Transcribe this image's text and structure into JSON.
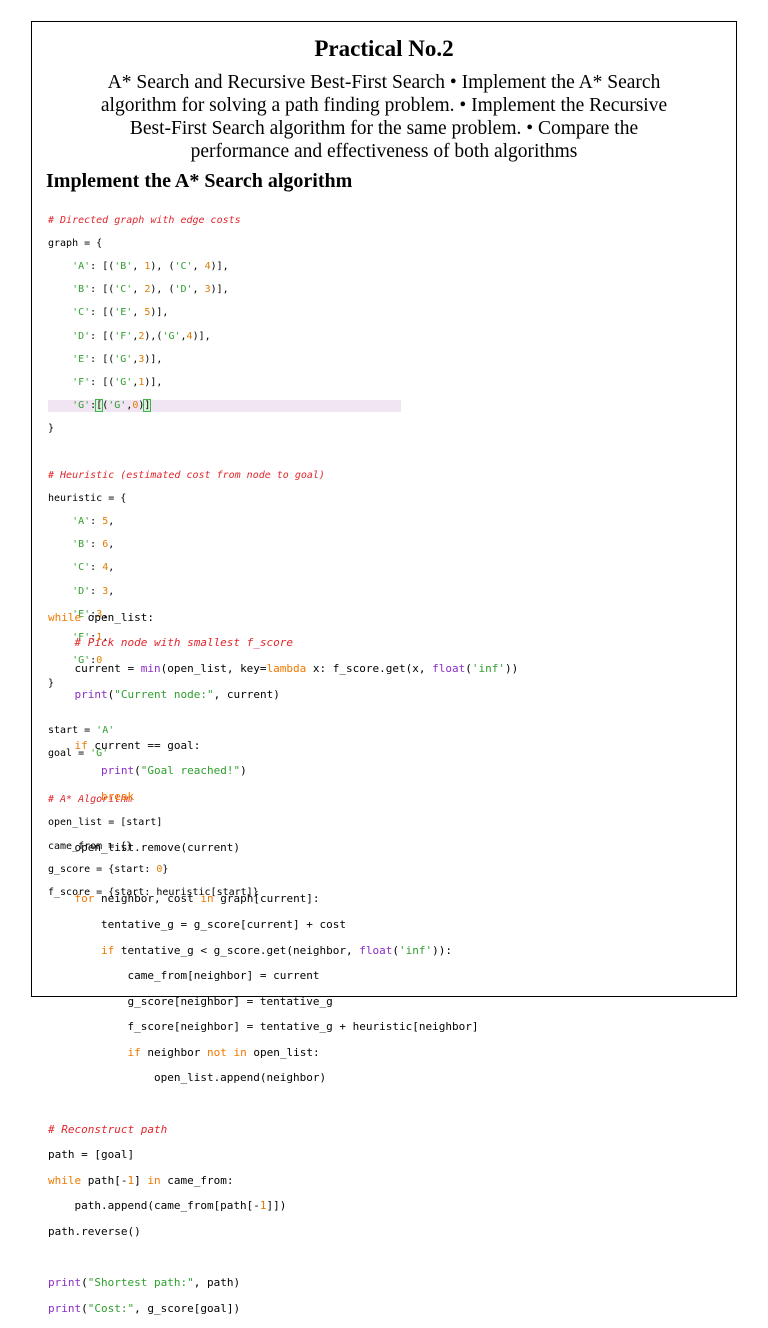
{
  "title": "Practical No.2",
  "description_lines": [
    "A* Search and Recursive Best-First Search • Implement the A* Search",
    "algorithm for solving a path finding problem. • Implement the Recursive",
    "Best-First Search algorithm for the same problem. • Compare the",
    "performance and effectiveness of both algorithms"
  ],
  "section_heading": "Implement the A* Search algorithm",
  "code_block_1": {
    "c1": "# Directed graph with edge costs",
    "l2": "graph = {",
    "l3a": "    ",
    "l3b": "'A'",
    "l3c": ": [(",
    "l3d": "'B'",
    "l3e": ", ",
    "l3f": "1",
    "l3g": "), (",
    "l3h": "'C'",
    "l3i": ", ",
    "l3j": "4",
    "l3k": ")],",
    "l4a": "    ",
    "l4b": "'B'",
    "l4c": ": [(",
    "l4d": "'C'",
    "l4e": ", ",
    "l4f": "2",
    "l4g": "), (",
    "l4h": "'D'",
    "l4i": ", ",
    "l4j": "3",
    "l4k": ")],",
    "l5a": "    ",
    "l5b": "'C'",
    "l5c": ": [(",
    "l5d": "'E'",
    "l5e": ", ",
    "l5f": "5",
    "l5g": ")],",
    "l6a": "    ",
    "l6b": "'D'",
    "l6c": ": [(",
    "l6d": "'F'",
    "l6e": ",",
    "l6f": "2",
    "l6g": "),(",
    "l6h": "'G'",
    "l6i": ",",
    "l6j": "4",
    "l6k": ")],",
    "l7a": "    ",
    "l7b": "'E'",
    "l7c": ": [(",
    "l7d": "'G'",
    "l7e": ",",
    "l7f": "3",
    "l7g": ")],",
    "l8a": "    ",
    "l8b": "'F'",
    "l8c": ": [(",
    "l8d": "'G'",
    "l8e": ",",
    "l8f": "1",
    "l8g": ")],",
    "l9a": "    ",
    "l9b": "'G'",
    "l9c": ":",
    "l9d": "[",
    "l9e": "(",
    "l9f": "'G'",
    "l9g": ",",
    "l9h": "0",
    "l9i": ")",
    "l9j": "]",
    "l10": "}",
    "c2": "# Heuristic (estimated cost from node to goal)",
    "h1": "heuristic = {",
    "h2a": "    ",
    "h2b": "'A'",
    "h2c": ": ",
    "h2d": "5",
    "h2e": ",",
    "h3a": "    ",
    "h3b": "'B'",
    "h3c": ": ",
    "h3d": "6",
    "h3e": ",",
    "h4a": "    ",
    "h4b": "'C'",
    "h4c": ": ",
    "h4d": "4",
    "h4e": ",",
    "h5a": "    ",
    "h5b": "'D'",
    "h5c": ": ",
    "h5d": "3",
    "h5e": ",",
    "h6a": "    ",
    "h6b": "'E'",
    "h6c": ":",
    "h6d": "3",
    "h6e": ",",
    "h7a": "    ",
    "h7b": "'F'",
    "h7c": ":",
    "h7d": "1",
    "h7e": ",",
    "h8a": "    ",
    "h8b": "'G'",
    "h8c": ":",
    "h8d": "0",
    "h9": "}",
    "s1a": "start = ",
    "s1b": "'A'",
    "s2a": "goal = ",
    "s2b": "'G'",
    "c3": "# A* Algorithm",
    "a1": "open_list = [start]",
    "a2": "came_from = {}",
    "a3a": "g_score = {start: ",
    "a3b": "0",
    "a3c": "}",
    "a4": "f_score = {start: heuristic[start]}"
  },
  "code_block_2": {
    "w1a": "while",
    "w1b": " open_list:",
    "w2": "    # Pick node with smallest f_score",
    "w3a": "    current = ",
    "w3b": "min",
    "w3c": "(open_list, key=",
    "w3d": "lambda",
    "w3e": " x: f_score.get(x, ",
    "w3f": "float",
    "w3g": "(",
    "w3h": "'inf'",
    "w3i": "))",
    "w4a": "    ",
    "w4b": "print",
    "w4c": "(",
    "w4d": "\"Current node:\"",
    "w4e": ", current)",
    "w5a": "    ",
    "w5b": "if",
    "w5c": " current == goal:",
    "w6a": "        ",
    "w6b": "print",
    "w6c": "(",
    "w6d": "\"Goal reached!\"",
    "w6e": ")",
    "w7a": "        ",
    "w7b": "break",
    "w8": "    open_list.remove(current)",
    "w9a": "    ",
    "w9b": "for",
    "w9c": " neighbor, cost ",
    "w9d": "in",
    "w9e": " graph[current]:",
    "w10": "        tentative_g = g_score[current] + cost",
    "w11a": "        ",
    "w11b": "if",
    "w11c": " tentative_g < g_score.get(neighbor, ",
    "w11d": "float",
    "w11e": "(",
    "w11f": "'inf'",
    "w11g": ")):",
    "w12": "            came_from[neighbor] = current",
    "w13": "            g_score[neighbor] = tentative_g",
    "w14": "            f_score[neighbor] = tentative_g + heuristic[neighbor]",
    "w15a": "            ",
    "w15b": "if",
    "w15c": " neighbor ",
    "w15d": "not in",
    "w15e": " open_list:",
    "w16": "                open_list.append(neighbor)",
    "r1": "# Reconstruct path",
    "r2": "path = [goal]",
    "r3a": "while",
    "r3b": " path[-",
    "r3c": "1",
    "r3d": "] ",
    "r3e": "in",
    "r3f": " came_from:",
    "r4a": "    path.append(came_from[path[-",
    "r4b": "1",
    "r4c": "]])",
    "r5": "path.reverse()",
    "p1a": "print",
    "p1b": "(",
    "p1c": "\"Shortest path:\"",
    "p1d": ", path)",
    "p2a": "print",
    "p2b": "(",
    "p2c": "\"Cost:\"",
    "p2d": ", g_score[goal])"
  }
}
